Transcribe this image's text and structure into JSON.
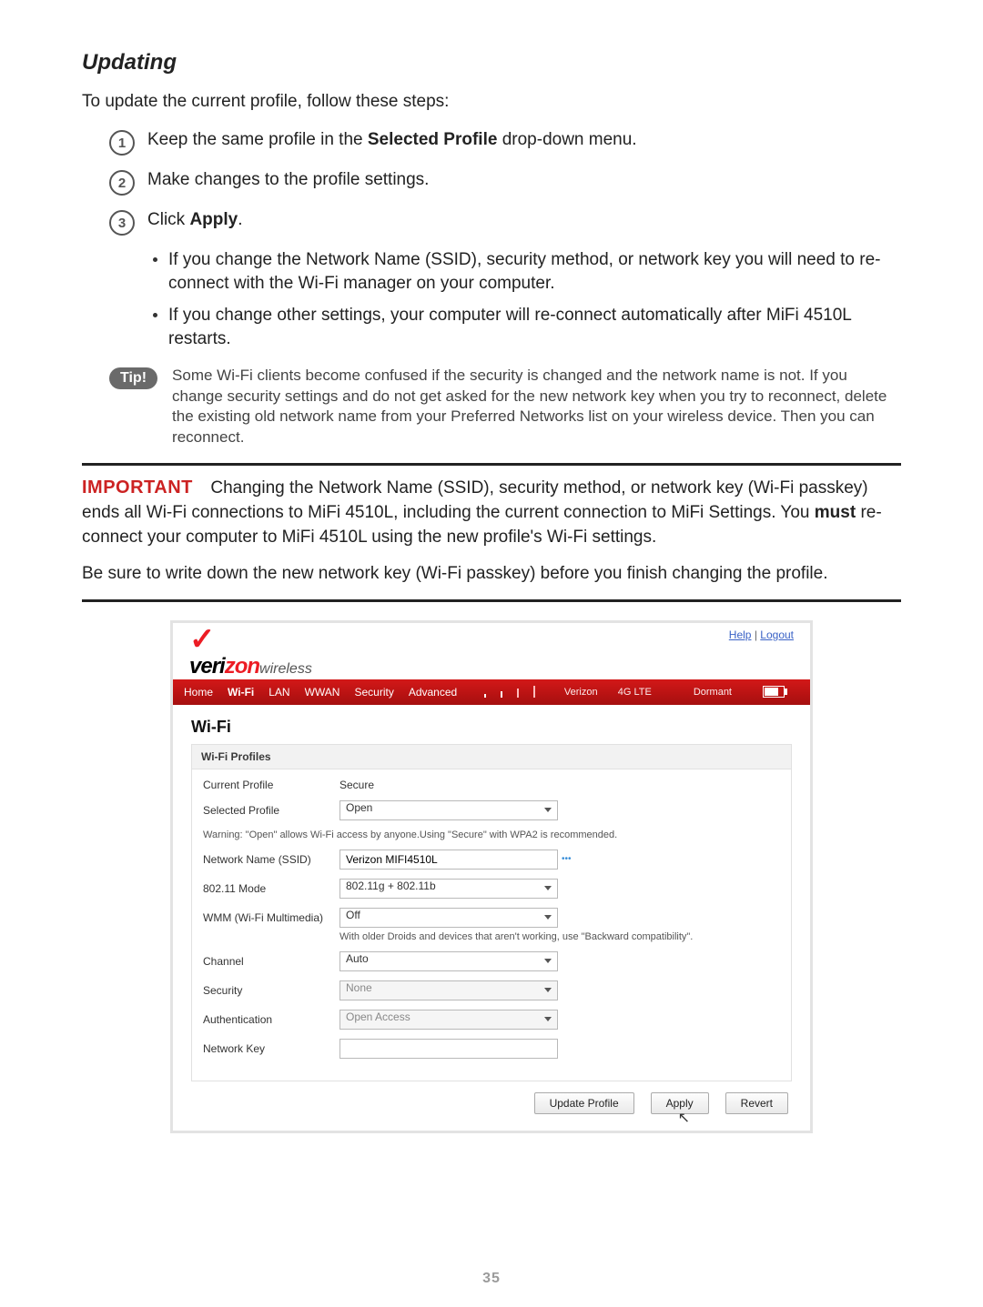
{
  "page_number": "35",
  "heading": "Updating",
  "intro": "To update the current profile, follow these steps:",
  "steps": {
    "s1_a": "Keep the same profile in the ",
    "s1_b": "Selected Profile",
    "s1_c": " drop-down menu.",
    "s2": "Make changes to the profile settings.",
    "s3_a": "Click ",
    "s3_b": "Apply",
    "s3_c": "."
  },
  "bullets": {
    "b1": "If you change the Network Name (SSID), security method, or network key you will need to re-connect with the Wi-Fi manager on your computer.",
    "b2": "If you change other settings, your computer will re-connect automatically after MiFi 4510L restarts."
  },
  "tip": {
    "label": "Tip!",
    "text": "Some Wi-Fi clients become confused if the security is changed and the network name is not. If you change security settings and do not get asked for the new network key when you try to reconnect, delete the existing old network name from your Preferred Networks list on your wireless device. Then you can reconnect."
  },
  "important": {
    "label": "IMPORTANT",
    "p1_a": "Changing the Network Name (SSID), security method, or network key (Wi-Fi passkey) ends all Wi-Fi connections to MiFi 4510L, including the current connection to MiFi Settings. You ",
    "p1_b": "must",
    "p1_c": " re-connect your computer to MiFi 4510L using the new profile's Wi-Fi settings.",
    "p2": "Be sure to write down the new network key (Wi-Fi passkey) before you finish changing the profile."
  },
  "ui": {
    "help": "Help",
    "logout": "Logout",
    "logo_wl": "wireless",
    "nav": {
      "home": "Home",
      "wifi": "Wi-Fi",
      "lan": "LAN",
      "wwan": "WWAN",
      "security": "Security",
      "advanced": "Advanced"
    },
    "status": {
      "carrier": "Verizon",
      "tech": "4G LTE",
      "state": "Dormant"
    },
    "title": "Wi-Fi",
    "panel_title": "Wi-Fi Profiles",
    "labels": {
      "current": "Current Profile",
      "selected": "Selected Profile",
      "ssid": "Network Name (SSID)",
      "mode": "802.11 Mode",
      "wmm": "WMM (Wi-Fi Multimedia)",
      "channel": "Channel",
      "security": "Security",
      "auth": "Authentication",
      "netkey": "Network Key"
    },
    "values": {
      "current": "Secure",
      "selected": "Open",
      "ssid": "Verizon MIFI4510L",
      "mode": "802.11g + 802.11b",
      "wmm": "Off",
      "channel": "Auto",
      "security": "None",
      "auth": "Open Access",
      "netkey": ""
    },
    "warn": "Warning: \"Open\" allows Wi-Fi access by anyone.Using \"Secure\" with WPA2 is recommended.",
    "hint": "With older Droids and devices that aren't working, use \"Backward compatibility\".",
    "buttons": {
      "update": "Update Profile",
      "apply": "Apply",
      "revert": "Revert"
    }
  }
}
